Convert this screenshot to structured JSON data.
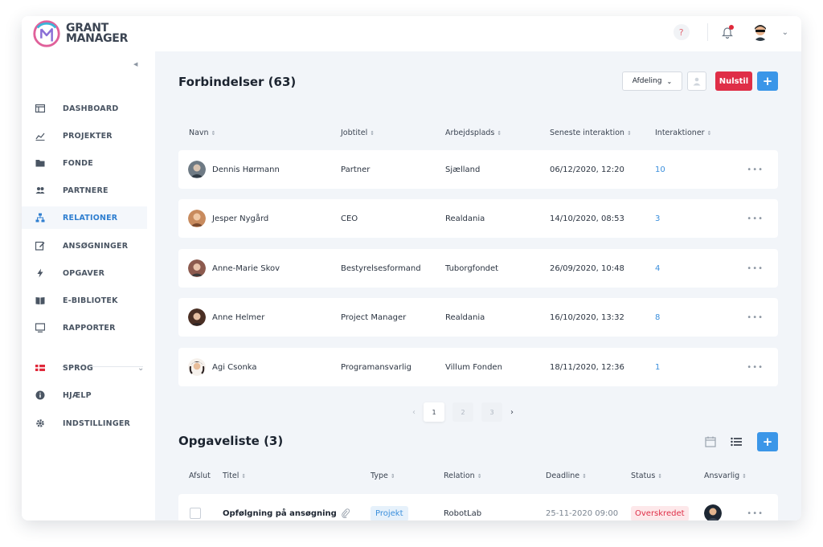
{
  "brand": {
    "line1": "GRANT",
    "line2": "MANAGER"
  },
  "topbar": {
    "help": "?"
  },
  "sidebar": {
    "items": [
      {
        "label": "DASHBOARD",
        "icon": "dashboard-icon"
      },
      {
        "label": "PROJEKTER",
        "icon": "chart-icon"
      },
      {
        "label": "FONDE",
        "icon": "folder-icon"
      },
      {
        "label": "PARTNERE",
        "icon": "users-icon"
      },
      {
        "label": "RELATIONER",
        "icon": "network-icon"
      },
      {
        "label": "ANSØGNINGER",
        "icon": "edit-icon"
      },
      {
        "label": "OPGAVER",
        "icon": "bolt-icon"
      },
      {
        "label": "E-BIBLIOTEK",
        "icon": "book-icon"
      },
      {
        "label": "RAPPORTER",
        "icon": "monitor-icon"
      }
    ],
    "language": "SPROG",
    "help": "HJÆLP",
    "settings": "INDSTILLINGER",
    "active_color": "#2f7fd0"
  },
  "connections": {
    "title": "Forbindelser (63)",
    "filter_label": "Afdeling",
    "reset_label": "Nulstil",
    "add_label": "+",
    "columns": [
      "Navn",
      "Jobtitel",
      "Arbejdsplads",
      "Seneste interaktion",
      "Interaktioner"
    ],
    "rows": [
      {
        "name": "Dennis Hørmann",
        "title": "Partner",
        "workplace": "Sjælland",
        "last": "06/12/2020, 12:20",
        "count": "10"
      },
      {
        "name": "Jesper Nygård",
        "title": "CEO",
        "workplace": "Realdania",
        "last": "14/10/2020, 08:53",
        "count": "3"
      },
      {
        "name": "Anne-Marie Skov",
        "title": "Bestyrelsesformand",
        "workplace": "Tuborgfondet",
        "last": "26/09/2020, 10:48",
        "count": "4"
      },
      {
        "name": "Anne Helmer",
        "title": "Project Manager",
        "workplace": "Realdania",
        "last": "16/10/2020, 13:32",
        "count": "8"
      },
      {
        "name": "Agi Csonka",
        "title": "Programansvarlig",
        "workplace": "Villum Fonden",
        "last": "18/11/2020, 12:36",
        "count": "1"
      }
    ],
    "more": "•••"
  },
  "pagination": {
    "prev": "‹",
    "pages": [
      "1",
      "2",
      "3"
    ],
    "next": "›"
  },
  "tasks": {
    "title": "Opgaveliste (3)",
    "add_label": "+",
    "columns": [
      "Afslut",
      "Titel",
      "Type",
      "Relation",
      "Deadline",
      "Status",
      "Ansvarlig"
    ],
    "rows": [
      {
        "title": "Opfølgning på ansøgning",
        "type": "Projekt",
        "relation": "RobotLab",
        "deadline": "25-11-2020 09:00",
        "status": "Overskredet"
      }
    ],
    "more": "•••"
  },
  "colors": {
    "primary": "#3b96e8",
    "danger": "#df2e47",
    "background": "#f2f5f9"
  }
}
